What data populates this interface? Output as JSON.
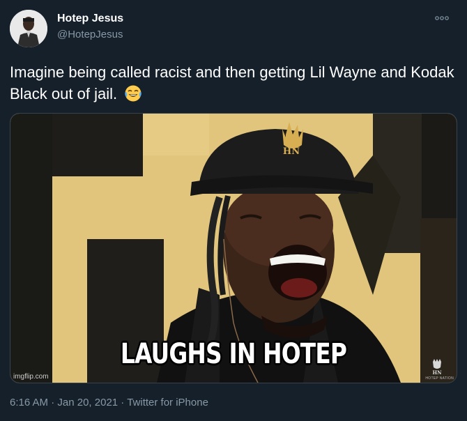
{
  "tweet": {
    "author_name": "Hotep Jesus",
    "author_handle": "@HotepJesus",
    "text": "Imagine being called racist and then getting Lil Wayne and Kodak Black out of jail.",
    "emoji_icon": "face-with-tears-of-joy-icon",
    "media": {
      "caption": "LAUGHS IN HOTEP",
      "watermark": "imgflip.com",
      "brand_text": "HOTEP NATION"
    },
    "time": "6:16 AM",
    "date": "Jan 20, 2021",
    "source": "Twitter for iPhone"
  },
  "colors": {
    "background": "#15202b",
    "secondary_text": "#8899a6",
    "border": "#38444d"
  }
}
